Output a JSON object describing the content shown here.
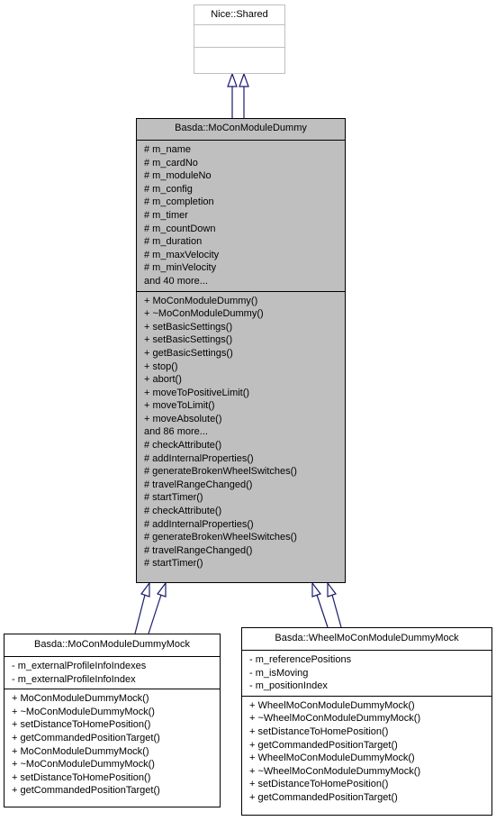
{
  "nodes": {
    "base": {
      "title": "Nice::Shared",
      "attributes": [],
      "methods": []
    },
    "focus": {
      "title": "Basda::MoConModuleDummy",
      "attributes": [
        "# m_name",
        "# m_cardNo",
        "# m_moduleNo",
        "# m_config",
        "# m_completion",
        "# m_timer",
        "# m_countDown",
        "# m_duration",
        "# m_maxVelocity",
        "# m_minVelocity",
        "and 40 more..."
      ],
      "methods": [
        "+ MoConModuleDummy()",
        "+ ~MoConModuleDummy()",
        "+ setBasicSettings()",
        "+ setBasicSettings()",
        "+ getBasicSettings()",
        "+ stop()",
        "+ abort()",
        "+ moveToPositiveLimit()",
        "+ moveToLimit()",
        "+ moveAbsolute()",
        "and 86 more...",
        "# checkAttribute()",
        "# addInternalProperties()",
        "# generateBrokenWheelSwitches()",
        "# travelRangeChanged()",
        "# startTimer()",
        "# checkAttribute()",
        "# addInternalProperties()",
        "# generateBrokenWheelSwitches()",
        "# travelRangeChanged()",
        "# startTimer()"
      ]
    },
    "mock": {
      "title": "Basda::MoConModuleDummyMock",
      "attributes": [
        "- m_externalProfileInfoIndexes",
        "- m_externalProfileInfoIndex"
      ],
      "methods": [
        "+ MoConModuleDummyMock()",
        "+ ~MoConModuleDummyMock()",
        "+ setDistanceToHomePosition()",
        "+ getCommandedPositionTarget()",
        "+ MoConModuleDummyMock()",
        "+ ~MoConModuleDummyMock()",
        "+ setDistanceToHomePosition()",
        "+ getCommandedPositionTarget()"
      ]
    },
    "wheel": {
      "title": "Basda::WheelMoConModuleDummyMock",
      "attributes": [
        "- m_referencePositions",
        "- m_isMoving",
        "- m_positionIndex"
      ],
      "methods": [
        "+ WheelMoConModuleDummyMock()",
        "+ ~WheelMoConModuleDummyMock()",
        "+ setDistanceToHomePosition()",
        "+ getCommandedPositionTarget()",
        "+ WheelMoConModuleDummyMock()",
        "+ ~WheelMoConModuleDummyMock()",
        "+ setDistanceToHomePosition()",
        "+ getCommandedPositionTarget()"
      ]
    }
  },
  "edges": [
    {
      "from": "focus",
      "to": "base",
      "type": "inheritance"
    },
    {
      "from": "focus",
      "to": "base",
      "type": "inheritance"
    },
    {
      "from": "mock",
      "to": "focus",
      "type": "inheritance"
    },
    {
      "from": "mock",
      "to": "focus",
      "type": "inheritance"
    },
    {
      "from": "wheel",
      "to": "focus",
      "type": "inheritance"
    },
    {
      "from": "wheel",
      "to": "focus",
      "type": "inheritance"
    }
  ],
  "colors": {
    "focus_fill": "#bfbfbf",
    "edge": "#191970",
    "faded_border": "#bfbfbf"
  }
}
